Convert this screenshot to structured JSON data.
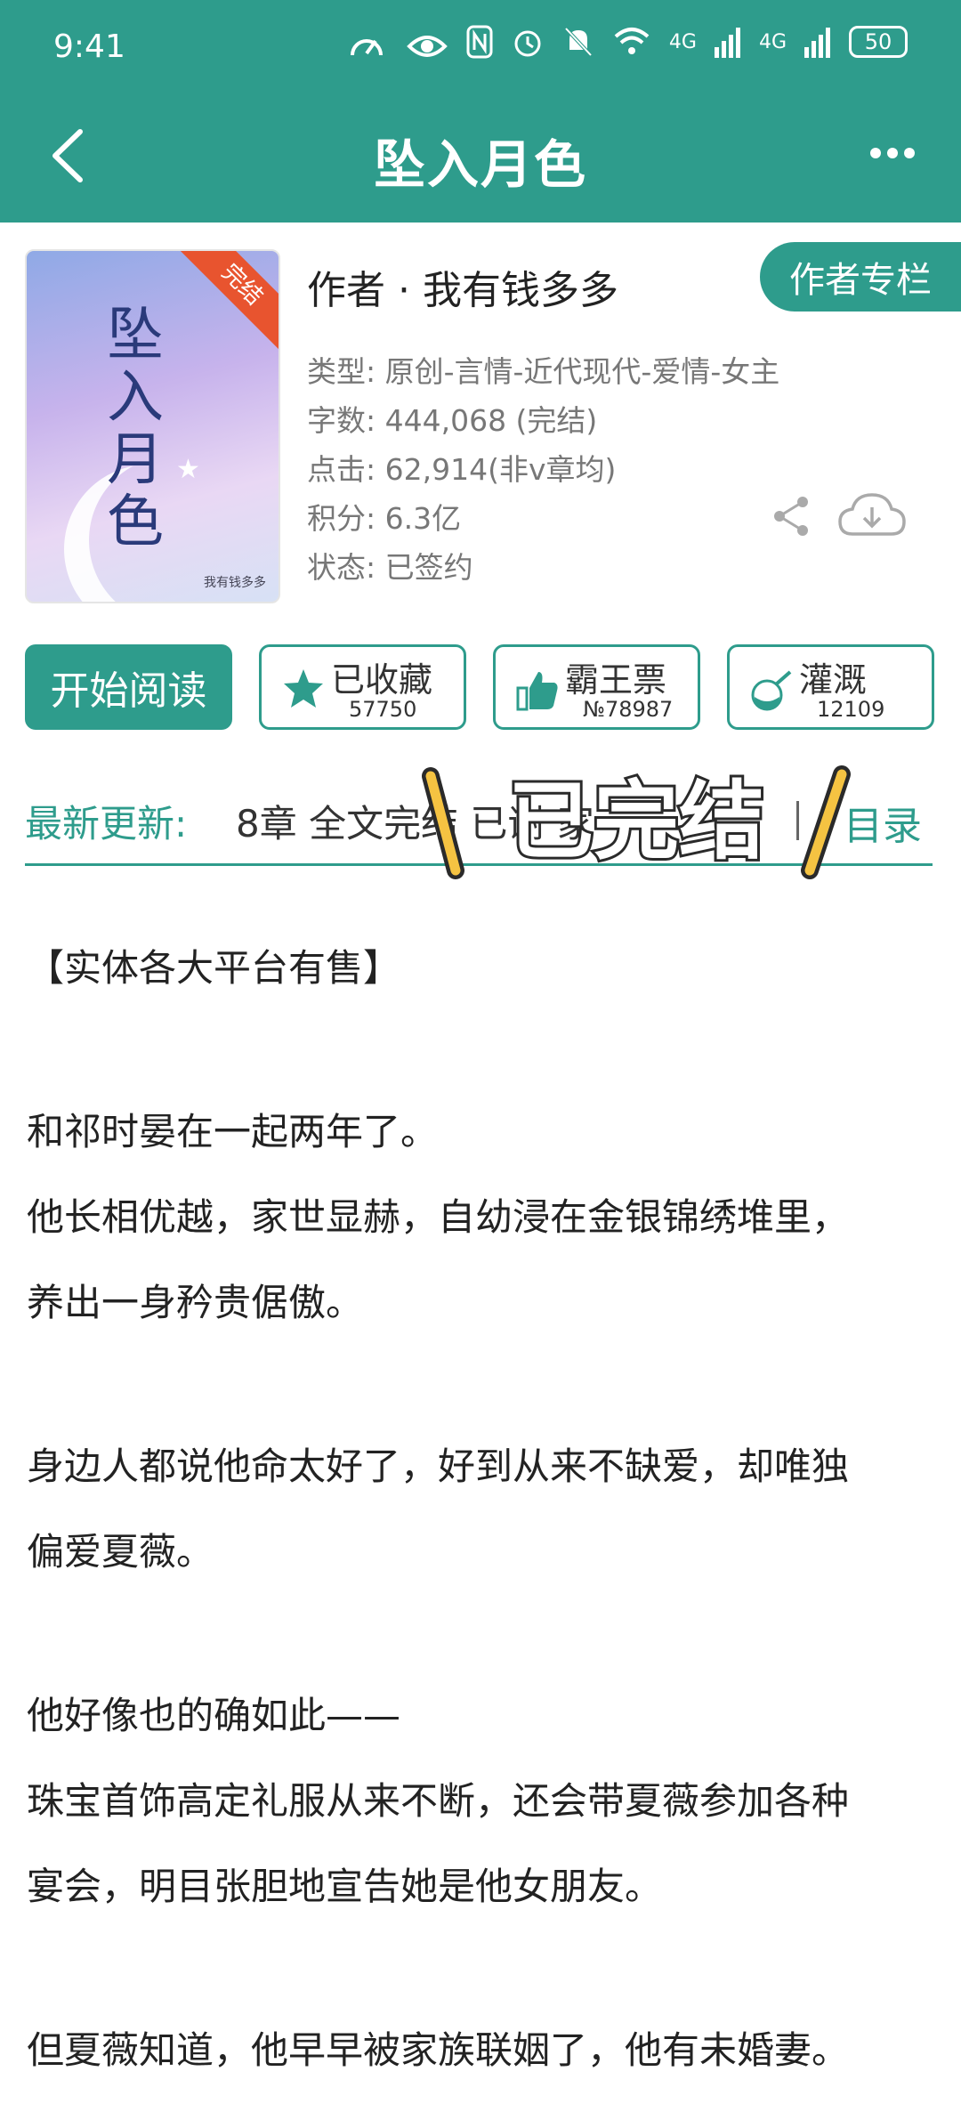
{
  "status_bar": {
    "time": "9:41",
    "signal_1": "4G",
    "signal_2": "4G",
    "battery": "50"
  },
  "header": {
    "title": "坠入月色"
  },
  "book": {
    "cover_badge": "完结",
    "cover_title": "坠入月色",
    "cover_author": "我有钱多多",
    "author_line": "作者 · 我有钱多多",
    "author_column_label": "作者专栏",
    "meta": [
      "类型: 原创-言情-近代现代-爱情-女主",
      "字数: 444,068 (完结)",
      "点击: 62,914(非v章均)",
      "积分: 6.3亿",
      "状态: 已签约"
    ]
  },
  "actions": {
    "read_label": "开始阅读",
    "favorite_label": "已收藏",
    "favorite_count": "57750",
    "vote_label": "霸王票",
    "vote_rank": "№78987",
    "nutrient_label": "灌溉",
    "nutrient_count": "12109"
  },
  "update": {
    "label": "最新更新:",
    "text": "8章 全文完结 已谢 家",
    "toc_label": "目录",
    "overlay_text": "已完结"
  },
  "content": {
    "paragraphs": [
      "【实体各大平台有售】",
      "",
      "和祁时晏在一起两年了。",
      "他长相优越，家世显赫，自幼浸在金银锦绣堆里，",
      "养出一身矜贵倨傲。",
      "",
      "身边人都说他命太好了，好到从来不缺爱，却唯独",
      "偏爱夏薇。",
      "",
      "他好像也的确如此——",
      "珠宝首饰高定礼服从来不断，还会带夏薇参加各种",
      "宴会，明目张胆地宣告她是他女朋友。",
      "",
      "但夏薇知道，他早早被家族联姻了，他有未婚妻。"
    ]
  },
  "colors": {
    "accent": "#2e9c8c",
    "ribbon": "#e8542f",
    "sticker": "#f5c342"
  }
}
